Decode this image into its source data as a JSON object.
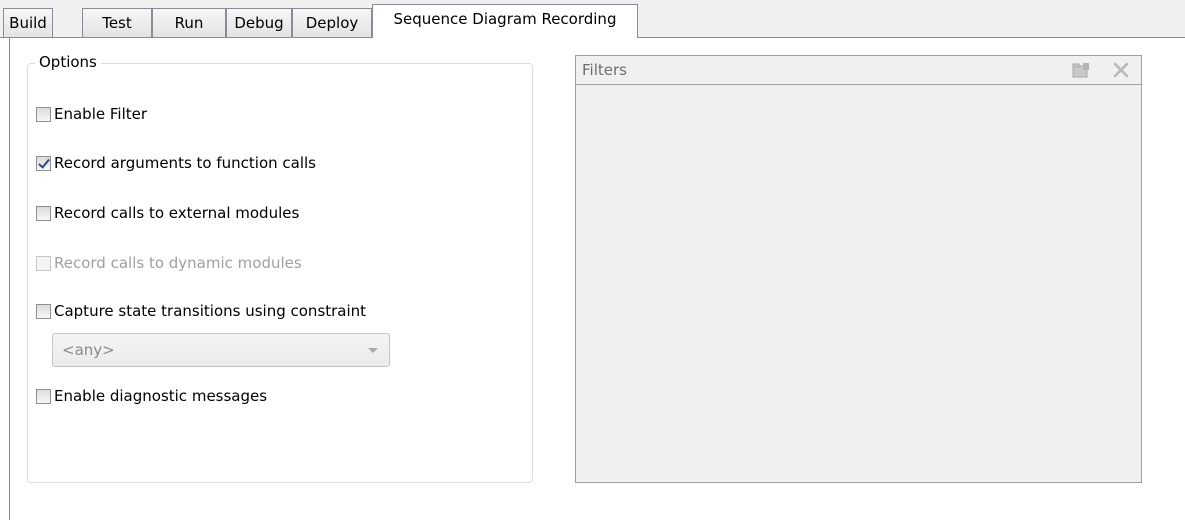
{
  "tabs": [
    {
      "label": "Build"
    },
    {
      "label": "Test"
    },
    {
      "label": "Run"
    },
    {
      "label": "Debug"
    },
    {
      "label": "Deploy"
    },
    {
      "label": "Sequence Diagram Recording",
      "active": true
    }
  ],
  "options": {
    "title": "Options",
    "enable_filter": {
      "label": "Enable Filter",
      "checked": false,
      "enabled": true
    },
    "record_arguments": {
      "label": "Record arguments to function calls",
      "checked": true,
      "enabled": true
    },
    "record_external": {
      "label": "Record calls to external modules",
      "checked": false,
      "enabled": true
    },
    "record_dynamic": {
      "label": "Record calls to dynamic modules",
      "checked": false,
      "enabled": false
    },
    "capture_state": {
      "label": "Capture state transitions using constraint",
      "checked": false,
      "enabled": true
    },
    "constraint_dropdown": {
      "value": "<any>",
      "enabled": false
    },
    "diagnostic_messages": {
      "label": "Enable diagnostic messages",
      "checked": false,
      "enabled": true
    }
  },
  "filters": {
    "title": "Filters",
    "add_icon": "folder-add-icon",
    "remove_icon": "close-icon"
  }
}
